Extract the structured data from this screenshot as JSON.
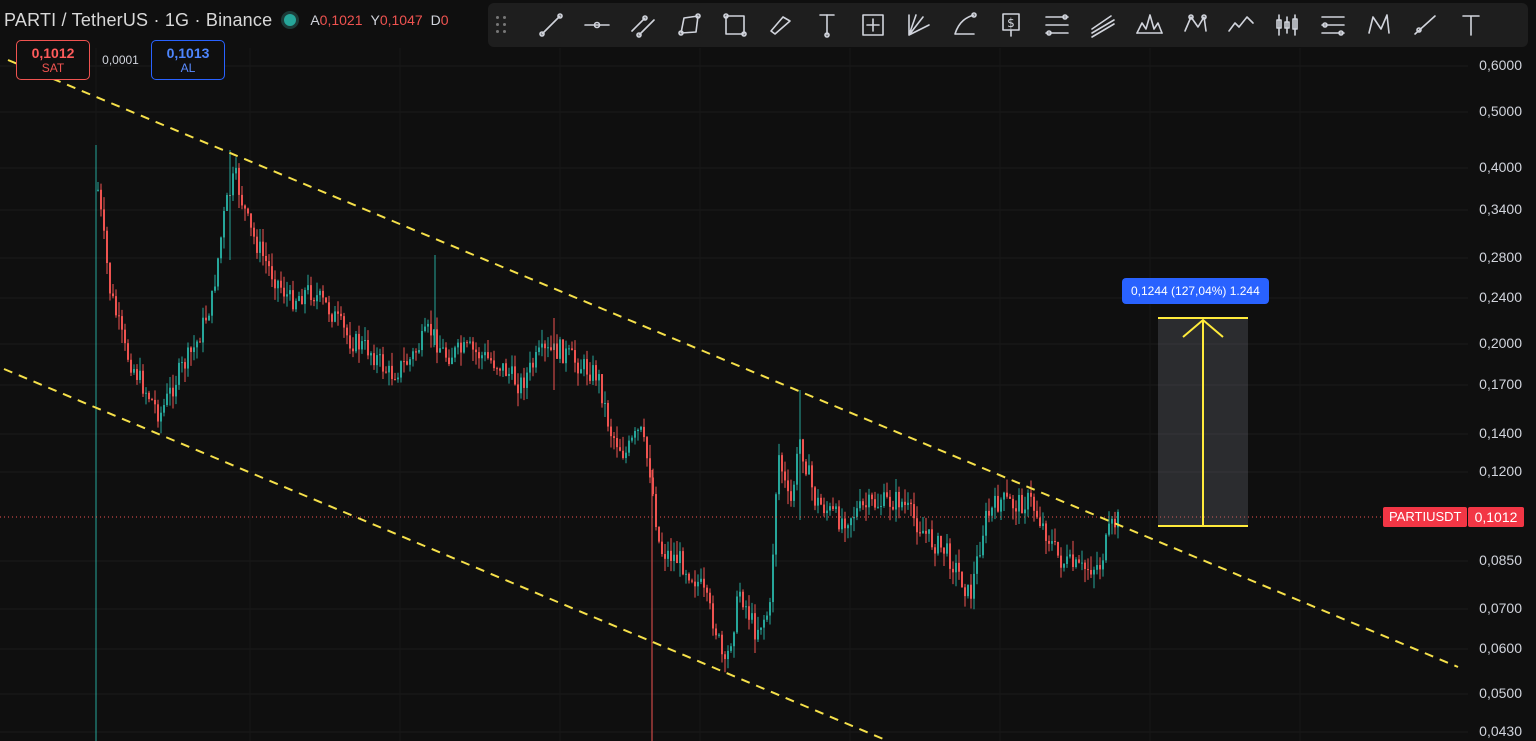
{
  "header": {
    "symbol_title": "PARTI / TetherUS · 1G · Binance",
    "ohlc": [
      {
        "key": "A",
        "value": "0,1021"
      },
      {
        "key": "Y",
        "value": "0,1047"
      },
      {
        "key": "D",
        "value": "0"
      }
    ]
  },
  "trade": {
    "sell_price": "0,1012",
    "sell_label": "SAT",
    "spread": "0,0001",
    "buy_price": "0,1013",
    "buy_label": "AL"
  },
  "toolbar": {
    "tools": [
      "trend-line-icon",
      "horizontal-ray-icon",
      "parallel-channel-icon",
      "polyline-icon",
      "rectangle-icon",
      "parallelogram-icon",
      "price-range-icon",
      "date-price-range-icon",
      "fib-fan-icon",
      "arc-icon",
      "price-note-icon",
      "fib-retracement-icon",
      "fib-channel-icon",
      "head-shoulders-icon",
      "xabcd-pattern-icon",
      "elliott-wave-icon",
      "candles-pattern-icon",
      "gann-box-icon",
      "triangle-pattern-icon",
      "ray-icon",
      "text-icon"
    ]
  },
  "price_axis": {
    "labels": [
      "0,6000",
      "0,5000",
      "0,4000",
      "0,3400",
      "0,2800",
      "0,2400",
      "0,2000",
      "0,1700",
      "0,1400",
      "0,1200",
      "0,0850",
      "0,0700",
      "0,0600",
      "0,0500",
      "0,0430"
    ],
    "scale": "log"
  },
  "price_tags": {
    "symbol": "PARTIUSDT",
    "current": "0,1012"
  },
  "measure": {
    "label": "0,1244 (127,04%) 1.244"
  },
  "colors": {
    "background": "#0f0f0f",
    "up": "#26a69a",
    "down": "#ef5350",
    "channel": "#f5e04a",
    "measure": "#ffeb3b",
    "accent": "#2962ff"
  }
}
